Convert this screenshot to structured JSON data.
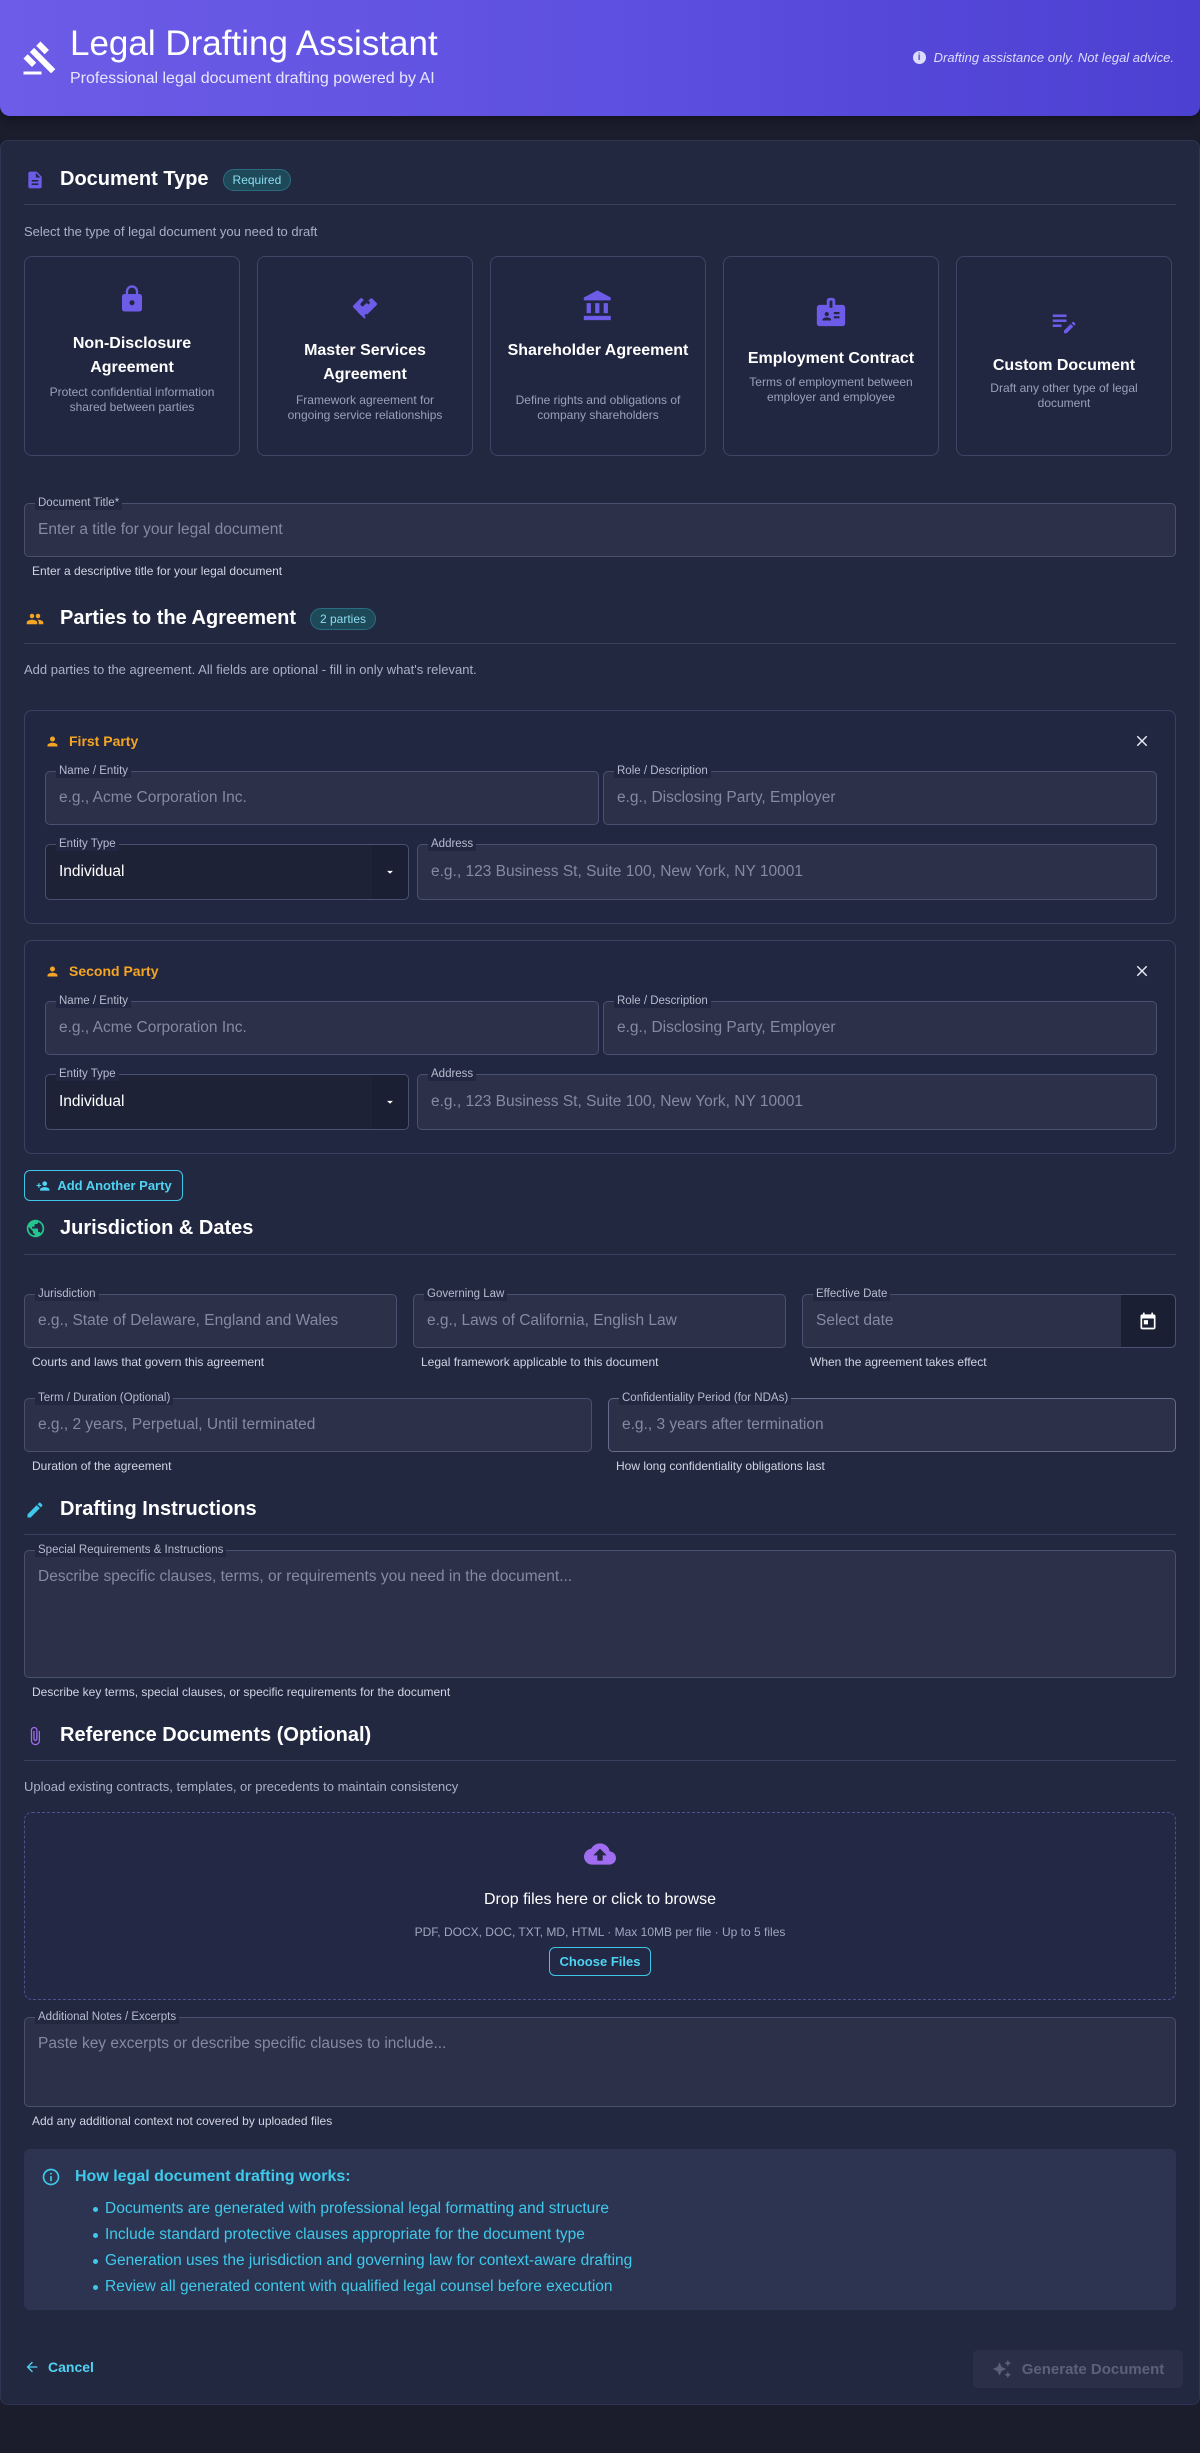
{
  "header": {
    "title": "Legal Drafting Assistant",
    "subtitle": "Professional legal document drafting powered by AI",
    "disclaimer": "Drafting assistance only. Not legal advice."
  },
  "doc_type": {
    "title": "Document Type",
    "badge": "Required",
    "description": "Select the type of legal document you need to draft",
    "cards": [
      {
        "title": "Non-Disclosure Agreement",
        "desc": "Protect confidential information shared between parties",
        "icon": "lock-icon"
      },
      {
        "title": "Master Services Agreement",
        "desc": "Framework agreement for ongoing service relationships",
        "icon": "handshake-icon"
      },
      {
        "title": "Shareholder Agreement",
        "desc": "Define rights and obligations of company shareholders",
        "icon": "bank-icon"
      },
      {
        "title": "Employment Contract",
        "desc": "Terms of employment between employer and employee",
        "icon": "badge-icon"
      },
      {
        "title": "Custom Document",
        "desc": "Draft any other type of legal document",
        "icon": "edit-note-icon"
      }
    ],
    "doc_title_label": "Document Title*",
    "doc_title_placeholder": "Enter a title for your legal document",
    "doc_title_helper": "Enter a descriptive title for your legal document"
  },
  "parties": {
    "title": "Parties to the Agreement",
    "badge": "2 parties",
    "description": "Add parties to the agreement. All fields are optional - fill in only what's relevant.",
    "name_label": "Name / Entity",
    "name_placeholder": "e.g., Acme Corporation Inc.",
    "role_label": "Role / Description",
    "role_placeholder": "e.g., Disclosing Party, Employer",
    "entity_label": "Entity Type",
    "entity_value": "Individual",
    "address_label": "Address",
    "address_placeholder": "e.g., 123 Business St, Suite 100, New York, NY 10001",
    "first": "First Party",
    "second": "Second Party",
    "add_button": "Add Another Party"
  },
  "jurisdiction": {
    "title": "Jurisdiction & Dates",
    "jurisdiction_label": "Jurisdiction",
    "jurisdiction_placeholder": "e.g., State of Delaware, England and Wales",
    "jurisdiction_helper": "Courts and laws that govern this agreement",
    "law_label": "Governing Law",
    "law_placeholder": "e.g., Laws of California, English Law",
    "law_helper": "Legal framework applicable to this document",
    "date_label": "Effective Date",
    "date_placeholder": "Select date",
    "date_helper": "When the agreement takes effect",
    "term_label": "Term / Duration (Optional)",
    "term_placeholder": "e.g., 2 years, Perpetual, Until terminated",
    "term_helper": "Duration of the agreement",
    "conf_label": "Confidentiality Period (for NDAs)",
    "conf_placeholder": "e.g., 3 years after termination",
    "conf_helper": "How long confidentiality obligations last"
  },
  "drafting": {
    "title": "Drafting Instructions",
    "label": "Special Requirements & Instructions",
    "placeholder": "Describe specific clauses, terms, or requirements you need in the document...",
    "helper": "Describe key terms, special clauses, or specific requirements for the document"
  },
  "reference": {
    "title": "Reference Documents (Optional)",
    "description": "Upload existing contracts, templates, or precedents to maintain consistency",
    "drop_title": "Drop files here or click to browse",
    "drop_hint": "PDF, DOCX, DOC, TXT, MD, HTML · Max 10MB per file · Up to 5 files",
    "choose_button": "Choose Files",
    "notes_label": "Additional Notes / Excerpts",
    "notes_placeholder": "Paste key excerpts or describe specific clauses to include...",
    "notes_helper": "Add any additional context not covered by uploaded files"
  },
  "info": {
    "title": "How legal document drafting works:",
    "items": [
      "Documents are generated with professional legal formatting and structure",
      "Include standard protective clauses appropriate for the document type",
      "Generation uses the jurisdiction and governing law for context-aware drafting",
      "Review all generated content with qualified legal counsel before execution"
    ]
  },
  "footer": {
    "cancel": "Cancel",
    "generate": "Generate Document"
  },
  "colors": {
    "accent_purple": "#6c5ce7",
    "accent_cyan": "#3fc9ea",
    "party_orange": "#f5a524",
    "jurisdiction_green": "#22c58b"
  }
}
